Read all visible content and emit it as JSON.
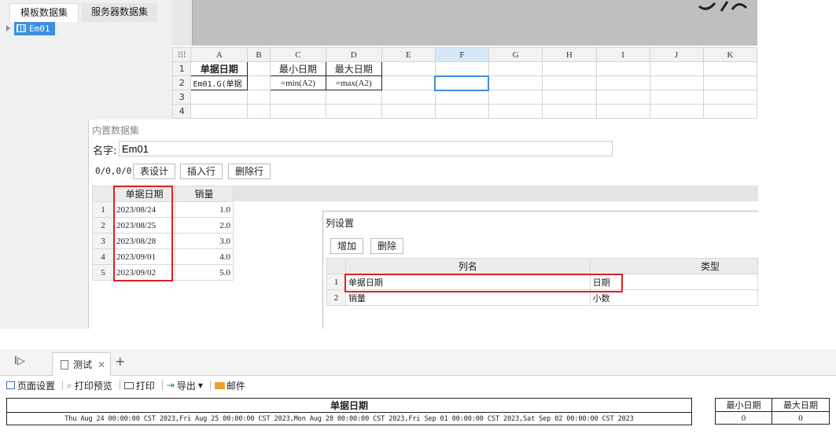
{
  "left_tabs": [
    "模板数据集",
    "服务器数据集"
  ],
  "tree": {
    "node": "Em01"
  },
  "sheet": {
    "col_headers": [
      "A",
      "B",
      "C",
      "D",
      "E",
      "F",
      "G",
      "H",
      "I",
      "J",
      "K"
    ],
    "row_numbers": [
      "1",
      "2",
      "3",
      "4"
    ],
    "a1": "单据日期",
    "c1": "最小日期",
    "d1": "最大日期",
    "a2": "Em01.G(单据",
    "c2": "=min(A2)",
    "d2": "=max(A2)"
  },
  "dataset": {
    "title": "内置数据集",
    "name_label": "名字:",
    "name_value": "Em01",
    "counter": "0/0,0/0",
    "buttons": [
      "表设计",
      "插入行",
      "删除行"
    ],
    "headers": [
      "单据日期",
      "销量"
    ],
    "rows": [
      {
        "n": "1",
        "date": "2023/08/24",
        "qty": "1.0"
      },
      {
        "n": "2",
        "date": "2023/08/25",
        "qty": "2.0"
      },
      {
        "n": "3",
        "date": "2023/08/28",
        "qty": "3.0"
      },
      {
        "n": "4",
        "date": "2023/09/01",
        "qty": "4.0"
      },
      {
        "n": "5",
        "date": "2023/09/02",
        "qty": "5.0"
      }
    ]
  },
  "colset": {
    "title": "列设置",
    "buttons": [
      "增加",
      "删除"
    ],
    "headers": [
      "列名",
      "类型"
    ],
    "rows": [
      {
        "n": "1",
        "name": "单据日期",
        "type": "日期"
      },
      {
        "n": "2",
        "name": "销量",
        "type": "小数"
      }
    ]
  },
  "bottom": {
    "tab_label": "测试",
    "toolbar": [
      "页面设置",
      "打印预览",
      "打印",
      "导出",
      "邮件"
    ],
    "preview": {
      "header": "单据日期",
      "value": "Thu Aug 24 00:00:00 CST 2023,Fri Aug 25 00:00:00 CST 2023,Mon Aug 28 00:00:00 CST 2023,Fri Sep 01 00:00:00 CST 2023,Sat Sep 02 00:00:00 CST 2023",
      "min_header": "最小日期",
      "max_header": "最大日期",
      "min_value": "0",
      "max_value": "0"
    }
  },
  "colors": {
    "accent": "#3d8fe0",
    "highlight_box": "#e02020",
    "mail_icon": "#f0a030"
  }
}
